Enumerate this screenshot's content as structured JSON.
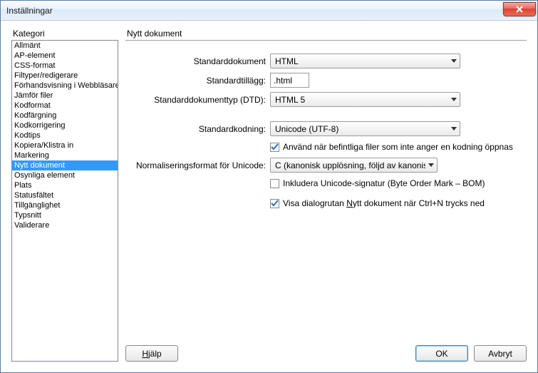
{
  "window": {
    "title": "Inställningar"
  },
  "left": {
    "label": "Kategori",
    "items": [
      "Allmänt",
      "AP-element",
      "CSS-format",
      "Filtyper/redigerare",
      "Förhandsvisning i Webbläsare",
      "Jämför filer",
      "Kodformat",
      "Kodfärgning",
      "Kodkorrigering",
      "Kodtips",
      "Kopiera/Klistra in",
      "Markering",
      "Nytt dokument",
      "Osynliga element",
      "Plats",
      "Statusfältet",
      "Tillgänglighet",
      "Typsnitt",
      "Validerare"
    ],
    "selected_index": 12
  },
  "section": {
    "title": "Nytt dokument"
  },
  "form": {
    "default_doc": {
      "label": "Standarddokument",
      "value": "HTML"
    },
    "default_ext": {
      "label": "Standardtillägg:",
      "value": ".html"
    },
    "default_dtd": {
      "label": "Standarddokumenttyp (DTD):",
      "value": "HTML 5"
    },
    "default_encoding": {
      "label": "Standardkodning:",
      "value": "Unicode (UTF-8)"
    },
    "apply_existing": {
      "label": "Använd när befintliga filer som inte anger en kodning öppnas",
      "checked": true
    },
    "normalization": {
      "label": "Normaliseringsformat för Unicode:",
      "value": "C (kanonisk upplösning, följd av kanonisk up"
    },
    "include_bom": {
      "label": "Inkludera Unicode-signatur (Byte Order Mark – BOM)",
      "checked": false
    },
    "show_dialog": {
      "prefix": "Visa dialogrutan ",
      "underlined": "N",
      "suffix": "ytt dokument när Ctrl+N trycks ned",
      "checked": true
    }
  },
  "buttons": {
    "help_underlined": "H",
    "help_rest": "jälp",
    "ok": "OK",
    "cancel": "Avbryt"
  }
}
